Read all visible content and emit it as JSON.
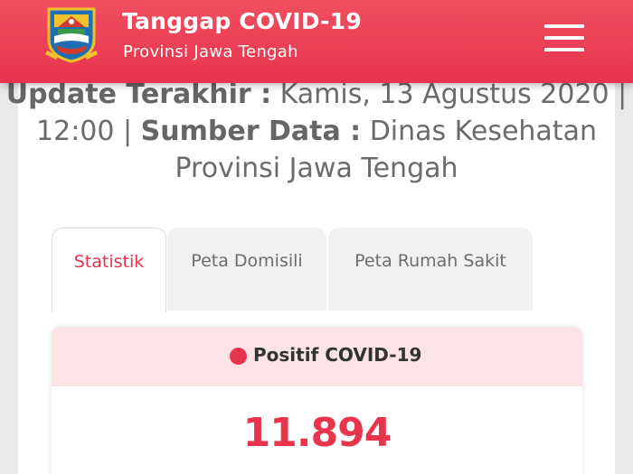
{
  "header": {
    "title": "Tanggap COVID-19",
    "subtitle": "Provinsi Jawa Tengah",
    "logo_icon": "jawa-tengah-emblem",
    "menu_icon": "hamburger-menu-icon",
    "color": "#e8344d"
  },
  "update": {
    "label_updated": "Update Terakhir :",
    "updated_value": "Kamis, 13 Agustus 2020 | 12:00 |",
    "label_source": "Sumber Data :",
    "source_value": "Dinas Kesehatan Provinsi Jawa Tengah"
  },
  "tabs": [
    {
      "label": "Statistik",
      "active": true
    },
    {
      "label": "Peta Domisili",
      "active": false
    },
    {
      "label": "Peta Rumah Sakit",
      "active": false
    }
  ],
  "stats": {
    "positive_label": "Positif COVID-19",
    "positive_value": "11.894",
    "accent_color": "#e8344d",
    "header_bg": "#fbe3e6"
  }
}
